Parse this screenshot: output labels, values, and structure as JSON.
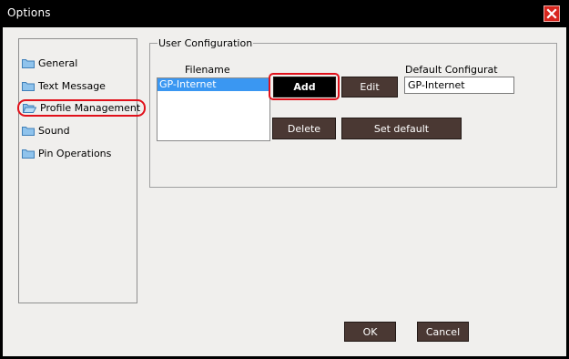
{
  "window": {
    "title": "Options",
    "close_icon": "close-icon"
  },
  "sidebar": {
    "items": [
      {
        "label": "General",
        "icon": "folder-icon",
        "selected": false
      },
      {
        "label": "Text Message",
        "icon": "folder-icon",
        "selected": false
      },
      {
        "label": "Profile Management",
        "icon": "folder-icon",
        "selected": true
      },
      {
        "label": "Sound",
        "icon": "folder-icon",
        "selected": false
      },
      {
        "label": "Pin Operations",
        "icon": "folder-icon",
        "selected": false
      }
    ]
  },
  "user_config": {
    "group_title": "User Configuration",
    "filename_header": "Filename",
    "files": [
      "GP-Internet"
    ],
    "default_label": "Default Configurat",
    "default_value": "GP-Internet",
    "buttons": {
      "add": "Add",
      "edit": "Edit",
      "delete": "Delete",
      "set_default": "Set default"
    }
  },
  "footer": {
    "ok": "OK",
    "cancel": "Cancel"
  },
  "colors": {
    "button_bg": "#4a3833",
    "selection": "#3a97f2",
    "highlight_ring": "#e1101a",
    "close_bg": "#d8261e"
  }
}
